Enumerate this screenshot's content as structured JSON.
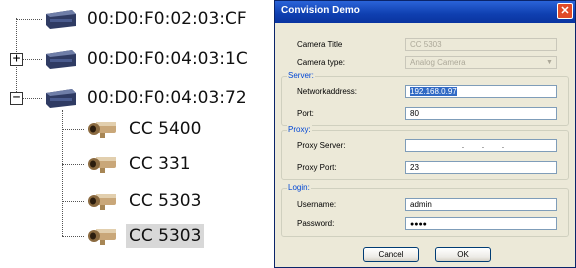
{
  "tree": {
    "devices": [
      {
        "label": "00:D0:F0:02:03:CF",
        "expander": ""
      },
      {
        "label": "00:D0:F0:04:03:1C",
        "expander": "+"
      },
      {
        "label": "00:D0:F0:04:03:72",
        "expander": "−"
      }
    ],
    "cameras": [
      {
        "label": "CC 5400"
      },
      {
        "label": "CC 331"
      },
      {
        "label": "CC 5303"
      },
      {
        "label": "CC 5303",
        "selected": true
      }
    ]
  },
  "dialog": {
    "title": "Convision Demo",
    "close_label": "✕",
    "camera_title_label": "Camera Title",
    "camera_title_value": "CC 5303",
    "camera_type_label": "Camera type:",
    "camera_type_value": "Analog Camera",
    "server_group": "Server:",
    "network_address_label": "Networkaddress:",
    "network_address_value": "192.168.0.97",
    "port_label": "Port:",
    "port_value": "80",
    "proxy_group": "Proxy:",
    "proxy_server_label": "Proxy Server:",
    "proxy_server_value": ".        .        .",
    "proxy_port_label": "Proxy Port:",
    "proxy_port_value": "23",
    "login_group": "Login:",
    "username_label": "Username:",
    "username_value": "admin",
    "password_label": "Password:",
    "password_value": "●●●●",
    "cancel_label": "Cancel",
    "ok_label": "OK"
  },
  "colors": {
    "titlebar": "#0f3fb0",
    "dialog_bg": "#ece9d8",
    "selection": "#316ac5"
  }
}
